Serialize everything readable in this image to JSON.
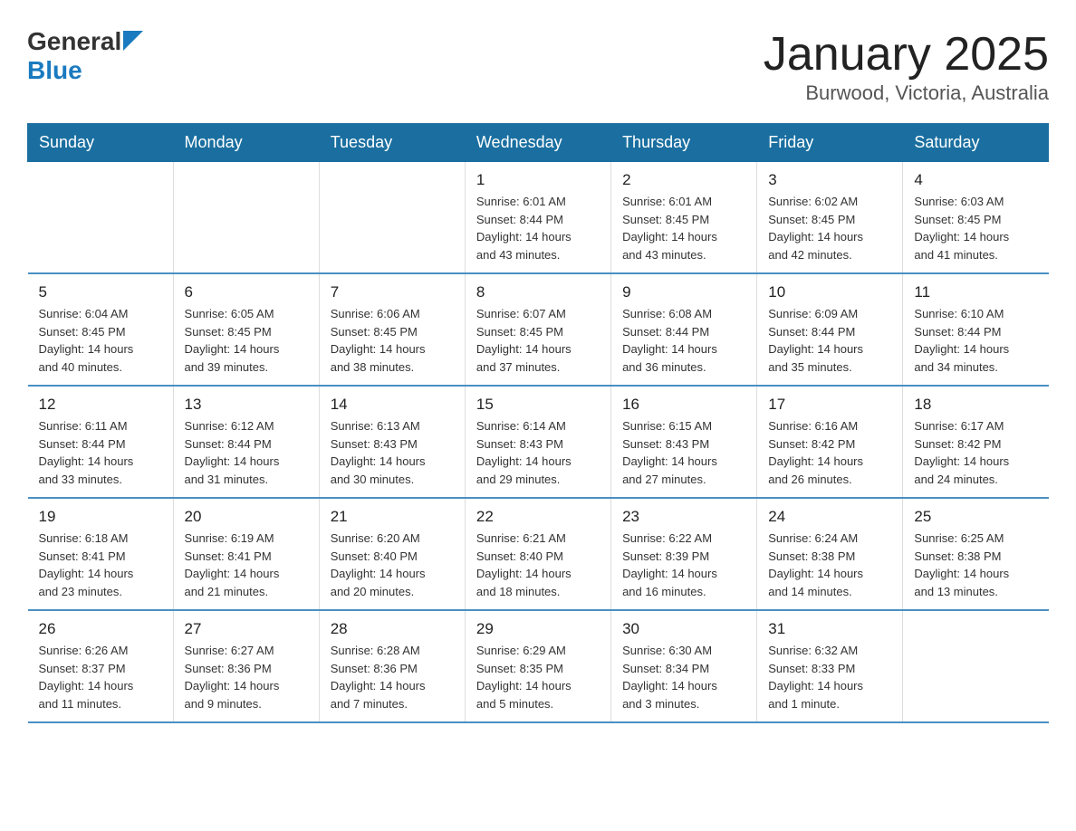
{
  "header": {
    "logo_general": "General",
    "logo_blue": "Blue",
    "month_title": "January 2025",
    "location": "Burwood, Victoria, Australia"
  },
  "weekdays": [
    "Sunday",
    "Monday",
    "Tuesday",
    "Wednesday",
    "Thursday",
    "Friday",
    "Saturday"
  ],
  "weeks": [
    [
      {
        "day": "",
        "info": ""
      },
      {
        "day": "",
        "info": ""
      },
      {
        "day": "",
        "info": ""
      },
      {
        "day": "1",
        "info": "Sunrise: 6:01 AM\nSunset: 8:44 PM\nDaylight: 14 hours\nand 43 minutes."
      },
      {
        "day": "2",
        "info": "Sunrise: 6:01 AM\nSunset: 8:45 PM\nDaylight: 14 hours\nand 43 minutes."
      },
      {
        "day": "3",
        "info": "Sunrise: 6:02 AM\nSunset: 8:45 PM\nDaylight: 14 hours\nand 42 minutes."
      },
      {
        "day": "4",
        "info": "Sunrise: 6:03 AM\nSunset: 8:45 PM\nDaylight: 14 hours\nand 41 minutes."
      }
    ],
    [
      {
        "day": "5",
        "info": "Sunrise: 6:04 AM\nSunset: 8:45 PM\nDaylight: 14 hours\nand 40 minutes."
      },
      {
        "day": "6",
        "info": "Sunrise: 6:05 AM\nSunset: 8:45 PM\nDaylight: 14 hours\nand 39 minutes."
      },
      {
        "day": "7",
        "info": "Sunrise: 6:06 AM\nSunset: 8:45 PM\nDaylight: 14 hours\nand 38 minutes."
      },
      {
        "day": "8",
        "info": "Sunrise: 6:07 AM\nSunset: 8:45 PM\nDaylight: 14 hours\nand 37 minutes."
      },
      {
        "day": "9",
        "info": "Sunrise: 6:08 AM\nSunset: 8:44 PM\nDaylight: 14 hours\nand 36 minutes."
      },
      {
        "day": "10",
        "info": "Sunrise: 6:09 AM\nSunset: 8:44 PM\nDaylight: 14 hours\nand 35 minutes."
      },
      {
        "day": "11",
        "info": "Sunrise: 6:10 AM\nSunset: 8:44 PM\nDaylight: 14 hours\nand 34 minutes."
      }
    ],
    [
      {
        "day": "12",
        "info": "Sunrise: 6:11 AM\nSunset: 8:44 PM\nDaylight: 14 hours\nand 33 minutes."
      },
      {
        "day": "13",
        "info": "Sunrise: 6:12 AM\nSunset: 8:44 PM\nDaylight: 14 hours\nand 31 minutes."
      },
      {
        "day": "14",
        "info": "Sunrise: 6:13 AM\nSunset: 8:43 PM\nDaylight: 14 hours\nand 30 minutes."
      },
      {
        "day": "15",
        "info": "Sunrise: 6:14 AM\nSunset: 8:43 PM\nDaylight: 14 hours\nand 29 minutes."
      },
      {
        "day": "16",
        "info": "Sunrise: 6:15 AM\nSunset: 8:43 PM\nDaylight: 14 hours\nand 27 minutes."
      },
      {
        "day": "17",
        "info": "Sunrise: 6:16 AM\nSunset: 8:42 PM\nDaylight: 14 hours\nand 26 minutes."
      },
      {
        "day": "18",
        "info": "Sunrise: 6:17 AM\nSunset: 8:42 PM\nDaylight: 14 hours\nand 24 minutes."
      }
    ],
    [
      {
        "day": "19",
        "info": "Sunrise: 6:18 AM\nSunset: 8:41 PM\nDaylight: 14 hours\nand 23 minutes."
      },
      {
        "day": "20",
        "info": "Sunrise: 6:19 AM\nSunset: 8:41 PM\nDaylight: 14 hours\nand 21 minutes."
      },
      {
        "day": "21",
        "info": "Sunrise: 6:20 AM\nSunset: 8:40 PM\nDaylight: 14 hours\nand 20 minutes."
      },
      {
        "day": "22",
        "info": "Sunrise: 6:21 AM\nSunset: 8:40 PM\nDaylight: 14 hours\nand 18 minutes."
      },
      {
        "day": "23",
        "info": "Sunrise: 6:22 AM\nSunset: 8:39 PM\nDaylight: 14 hours\nand 16 minutes."
      },
      {
        "day": "24",
        "info": "Sunrise: 6:24 AM\nSunset: 8:38 PM\nDaylight: 14 hours\nand 14 minutes."
      },
      {
        "day": "25",
        "info": "Sunrise: 6:25 AM\nSunset: 8:38 PM\nDaylight: 14 hours\nand 13 minutes."
      }
    ],
    [
      {
        "day": "26",
        "info": "Sunrise: 6:26 AM\nSunset: 8:37 PM\nDaylight: 14 hours\nand 11 minutes."
      },
      {
        "day": "27",
        "info": "Sunrise: 6:27 AM\nSunset: 8:36 PM\nDaylight: 14 hours\nand 9 minutes."
      },
      {
        "day": "28",
        "info": "Sunrise: 6:28 AM\nSunset: 8:36 PM\nDaylight: 14 hours\nand 7 minutes."
      },
      {
        "day": "29",
        "info": "Sunrise: 6:29 AM\nSunset: 8:35 PM\nDaylight: 14 hours\nand 5 minutes."
      },
      {
        "day": "30",
        "info": "Sunrise: 6:30 AM\nSunset: 8:34 PM\nDaylight: 14 hours\nand 3 minutes."
      },
      {
        "day": "31",
        "info": "Sunrise: 6:32 AM\nSunset: 8:33 PM\nDaylight: 14 hours\nand 1 minute."
      },
      {
        "day": "",
        "info": ""
      }
    ]
  ]
}
